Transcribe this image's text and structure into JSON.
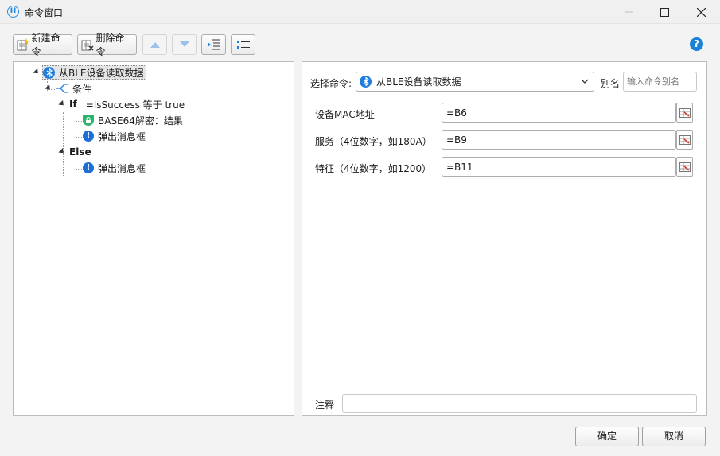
{
  "window": {
    "title": "命令窗口",
    "app_icon_letter": "H"
  },
  "toolbar": {
    "new_command_label": "新建命令",
    "delete_command_label": "删除命令"
  },
  "tree": {
    "root_label": "从BLE设备读取数据",
    "condition_label": "条件",
    "if_keyword": "If",
    "if_condition": "=IsSuccess 等于 true",
    "base64_label": "BASE64解密：结果",
    "popup_label_1": "弹出消息框",
    "else_keyword": "Else",
    "popup_label_2": "弹出消息框"
  },
  "command": {
    "select_label": "选择命令:",
    "selected_value": "从BLE设备读取数据",
    "alias_label": "别名",
    "alias_placeholder": "输入命令别名"
  },
  "params": [
    {
      "label": "设备MAC地址",
      "value": "=B6"
    },
    {
      "label": "服务（4位数字，如180A）",
      "value": "=B9"
    },
    {
      "label": "特征（4位数字，如1200）",
      "value": "=B11"
    }
  ],
  "note": {
    "label": "注释",
    "value": ""
  },
  "footer": {
    "ok_label": "确定",
    "cancel_label": "取消"
  },
  "colors": {
    "accent_blue": "#1f7de0",
    "lock_green": "#29b36b"
  }
}
